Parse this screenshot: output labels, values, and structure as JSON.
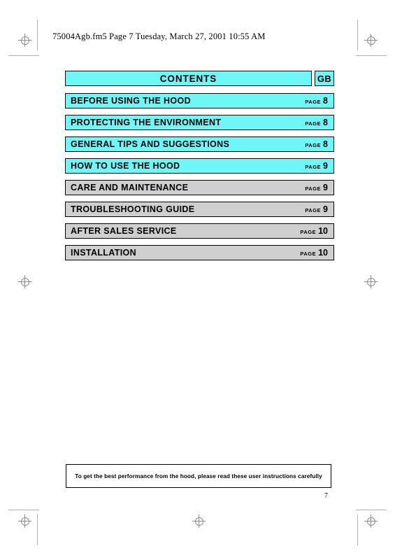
{
  "document": {
    "header_line": "75004Agb.fm5  Page 7  Tuesday, March 27, 2001  10:55 AM",
    "page_number": "7"
  },
  "contents": {
    "title": "CONTENTS",
    "language_code": "GB",
    "page_word": "PAGE",
    "entries": [
      {
        "label": "BEFORE USING THE HOOD",
        "page": "8",
        "color": "#6ff6f6"
      },
      {
        "label": "PROTECTING THE ENVIRONMENT",
        "page": "8",
        "color": "#6ff6f6"
      },
      {
        "label": "GENERAL TIPS AND SUGGESTIONS",
        "page": "8",
        "color": "#6ff6f6"
      },
      {
        "label": "HOW TO USE THE HOOD",
        "page": "9",
        "color": "#6ff6f6"
      },
      {
        "label": "CARE AND MAINTENANCE",
        "page": "9",
        "color": "#cfcfcf"
      },
      {
        "label": "TROUBLESHOOTING GUIDE",
        "page": "9",
        "color": "#cfcfcf"
      },
      {
        "label": "AFTER SALES SERVICE",
        "page": "10",
        "color": "#cfcfcf"
      },
      {
        "label": "INSTALLATION",
        "page": "10",
        "color": "#cfcfcf"
      }
    ]
  },
  "footer": {
    "notice": "To get the best performance from the hood, please read these user instructions carefully"
  },
  "colors": {
    "cyan": "#6ff6f6",
    "gray": "#cfcfcf",
    "border": "#000000",
    "mark": "#8d8d8d"
  }
}
